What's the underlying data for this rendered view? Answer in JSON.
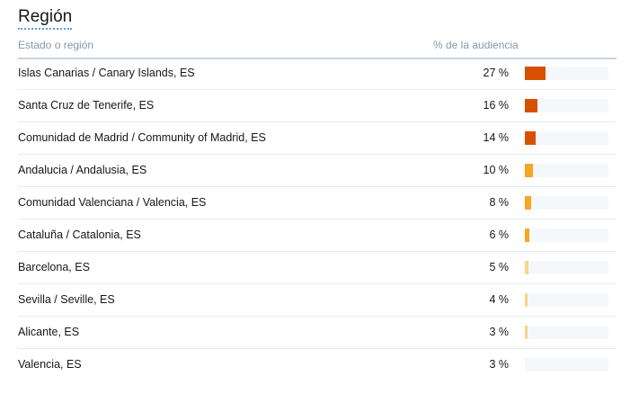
{
  "title": "Región",
  "header": {
    "region_label": "Estado o región",
    "pct_label": "% de la audiencia"
  },
  "colors": {
    "high": "#d84f00",
    "mid": "#f5a623",
    "low": "#fbd38d"
  },
  "rows": [
    {
      "name": "Islas Canarias / Canary Islands, ES",
      "pct_text": "27 %",
      "value": 27,
      "color": "#d84f00"
    },
    {
      "name": "Santa Cruz de Tenerife, ES",
      "pct_text": "16 %",
      "value": 16,
      "color": "#d84f00"
    },
    {
      "name": "Comunidad de Madrid / Community of Madrid, ES",
      "pct_text": "14 %",
      "value": 14,
      "color": "#d84f00"
    },
    {
      "name": "Andalucia / Andalusia, ES",
      "pct_text": "10 %",
      "value": 10,
      "color": "#f5a623"
    },
    {
      "name": "Comunidad Valenciana / Valencia, ES",
      "pct_text": "8 %",
      "value": 8,
      "color": "#f5a623"
    },
    {
      "name": "Cataluña / Catalonia, ES",
      "pct_text": "6 %",
      "value": 6,
      "color": "#f5a623"
    },
    {
      "name": "Barcelona, ES",
      "pct_text": "5 %",
      "value": 5,
      "color": "#fbd38d"
    },
    {
      "name": "Sevilla / Seville, ES",
      "pct_text": "4 %",
      "value": 4,
      "color": "#fbd38d"
    },
    {
      "name": "Alicante, ES",
      "pct_text": "3 %",
      "value": 3,
      "color": "#fbd38d"
    },
    {
      "name": "Valencia, ES",
      "pct_text": "3 %",
      "value": 3,
      "color": "#f5f8fa"
    }
  ]
}
